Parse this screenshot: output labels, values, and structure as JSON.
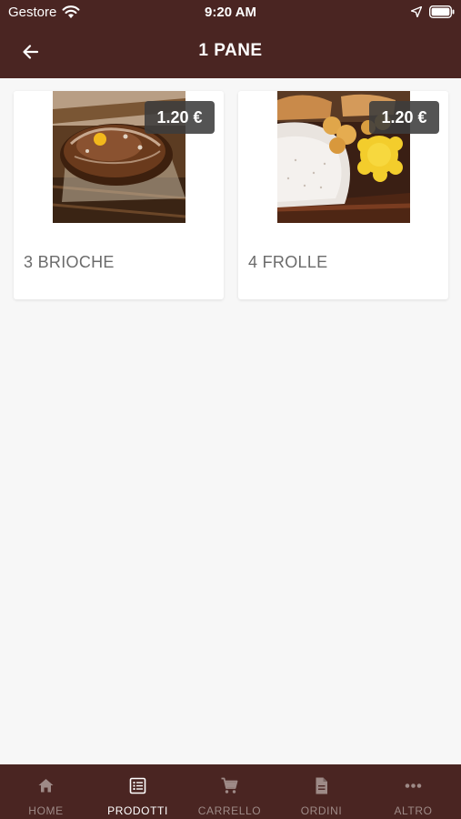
{
  "status_bar": {
    "carrier": "Gestore",
    "time": "9:20 AM"
  },
  "header": {
    "title": "1 PANE",
    "back_icon": "arrow-left-icon"
  },
  "products": [
    {
      "name": "3 BRIOCHE",
      "price": "1.20 €"
    },
    {
      "name": "4 FROLLE",
      "price": "1.20 €"
    }
  ],
  "tabbar": {
    "active": "PRODOTTI",
    "items": [
      {
        "label": "HOME",
        "icon": "home-icon"
      },
      {
        "label": "PRODOTTI",
        "icon": "list-icon"
      },
      {
        "label": "CARRELLO",
        "icon": "cart-icon"
      },
      {
        "label": "ORDINI",
        "icon": "document-icon"
      },
      {
        "label": "ALTRO",
        "icon": "more-icon"
      }
    ]
  },
  "colors": {
    "brand": "#4a2522",
    "background": "#f7f7f7",
    "card": "#ffffff",
    "badge": "#3c3c3c"
  }
}
